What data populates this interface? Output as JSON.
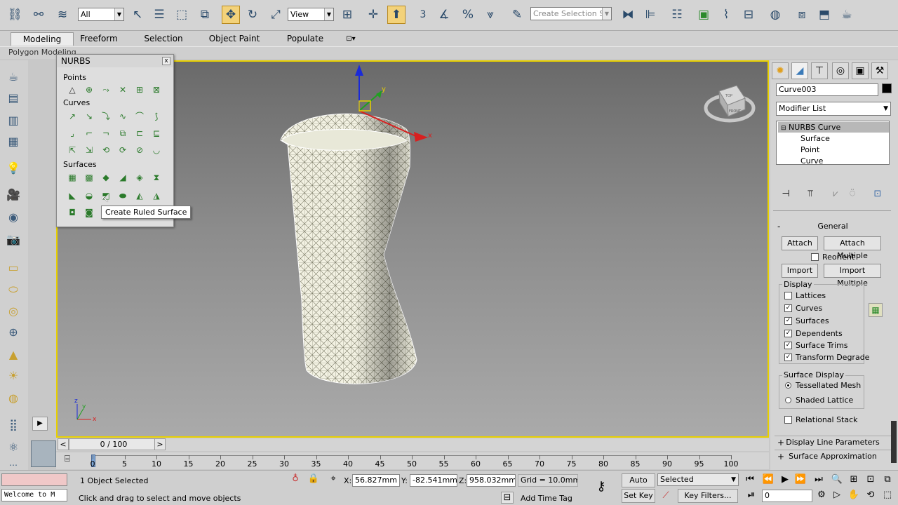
{
  "toolbar": {
    "selection_filter": "All",
    "ref_coord": "View",
    "named_selection_placeholder": "Create Selection Se",
    "snap_label": "3"
  },
  "ribbon": {
    "tabs": [
      "Modeling",
      "Freeform",
      "Selection",
      "Object Paint",
      "Populate"
    ],
    "active_tab": "Modeling",
    "sub_label": "Polygon Modeling"
  },
  "nurbs_panel": {
    "title": "NURBS",
    "close": "x",
    "sections": {
      "points": "Points",
      "curves": "Curves",
      "surfaces": "Surfaces"
    },
    "tooltip": "Create Ruled Surface"
  },
  "viewport": {
    "gizmo_x": "x",
    "gizmo_y": "y",
    "viewcube_top": "TOP",
    "viewcube_front": "FRONT",
    "axis_x": "x",
    "axis_y": "y",
    "axis_z": "z"
  },
  "command_panel": {
    "object_name": "Curve003",
    "modifier_list": "Modifier List",
    "stack": {
      "root": "NURBS Curve",
      "children": [
        "Surface",
        "Point",
        "Curve"
      ]
    },
    "general": {
      "title": "General",
      "attach": "Attach",
      "attach_multiple": "Attach Multiple",
      "reorient": "Reorient",
      "import": "Import",
      "import_multiple": "Import Multiple",
      "display_label": "Display",
      "display_items": [
        {
          "label": "Lattices",
          "checked": false
        },
        {
          "label": "Curves",
          "checked": true
        },
        {
          "label": "Surfaces",
          "checked": true
        },
        {
          "label": "Dependents",
          "checked": true
        },
        {
          "label": "Surface Trims",
          "checked": true
        },
        {
          "label": "Transform Degrade",
          "checked": true
        }
      ],
      "surface_display_label": "Surface Display",
      "tessellated_mesh": "Tessellated Mesh",
      "shaded_lattice": "Shaded Lattice",
      "relational_stack": "Relational Stack"
    },
    "rollouts": {
      "general_sign": "-",
      "display_line_sign": "+",
      "display_line": "Display Line Parameters",
      "surface_approx_sign": "+",
      "surface_approx": "Surface Approximation"
    }
  },
  "time": {
    "frame_display": "0 / 100",
    "prev": "<",
    "next": ">",
    "ticks": [
      "0",
      "5",
      "10",
      "15",
      "20",
      "25",
      "30",
      "35",
      "40",
      "45",
      "50",
      "55",
      "60",
      "65",
      "70",
      "75",
      "80",
      "85",
      "90",
      "95",
      "100"
    ]
  },
  "status": {
    "welcome": "Welcome to M",
    "selected": "1 Object Selected",
    "prompt": "Click and drag to select and move objects",
    "x_label": "X:",
    "x_value": "56.827mm",
    "y_label": "Y:",
    "y_value": "-82.541mm",
    "z_label": "Z:",
    "z_value": "958.032mm",
    "grid": "Grid = 10.0mm",
    "add_time_tag": "Add Time Tag",
    "auto_key": "Auto Key",
    "set_key": "Set Key",
    "key_mode": "Selected",
    "key_filters": "Key Filters...",
    "current_frame": "0"
  }
}
